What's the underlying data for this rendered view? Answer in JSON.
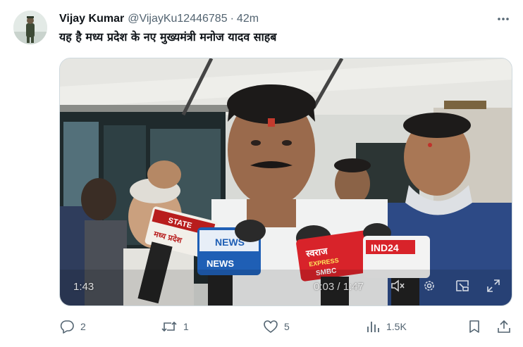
{
  "author": {
    "name": "Vijay Kumar",
    "handle": "@VijayKu12446785",
    "separator": "·",
    "time": "42m"
  },
  "tweet": {
    "text": "यह है मध्य प्रदेश के नए मुख्यमंत्री मनोज यादव साहब"
  },
  "media": {
    "elapsed_left": "1:43",
    "playback": "0:03 / 1:47",
    "mic_labels": {
      "state": "STATE",
      "news": "NEWS",
      "mp": "मध्य प्रदेश",
      "channel_logo": "NEWS",
      "swaraj": "स्वराज",
      "swaraj_sub": "EXPRESS",
      "smbc": "SMBC",
      "ind24": "IND24"
    }
  },
  "actions": {
    "reply_count": "2",
    "retweet_count": "1",
    "like_count": "5",
    "views_count": "1.5K"
  },
  "colors": {
    "text_primary": "#0f1419",
    "text_secondary": "#536471",
    "border": "#cfd9de"
  },
  "icons": {
    "reply": "reply-icon",
    "retweet": "retweet-icon",
    "like": "heart-icon",
    "views": "analytics-icon",
    "bookmark": "bookmark-icon",
    "share": "share-icon",
    "more": "more-dots-icon",
    "mute": "volume-mute-icon",
    "settings": "gear-icon",
    "pip": "picture-in-picture-icon",
    "fullscreen": "fullscreen-icon"
  }
}
